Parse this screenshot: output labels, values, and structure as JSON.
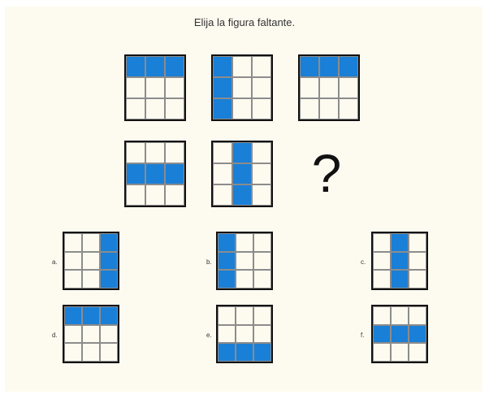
{
  "prompt": "Elija la figura faltante.",
  "question_mark": "?",
  "colors": {
    "fill": "#1a7fd6",
    "background": "#fdfbf0",
    "border": "#111111"
  },
  "puzzle": [
    [
      1,
      1,
      1,
      0,
      0,
      0,
      0,
      0,
      0
    ],
    [
      1,
      0,
      0,
      1,
      0,
      0,
      1,
      0,
      0
    ],
    [
      1,
      1,
      1,
      0,
      0,
      0,
      0,
      0,
      0
    ],
    [
      0,
      0,
      0,
      1,
      1,
      1,
      0,
      0,
      0
    ],
    [
      0,
      1,
      0,
      0,
      1,
      0,
      0,
      1,
      0
    ]
  ],
  "options": [
    {
      "label": "a.",
      "cells": [
        0,
        0,
        1,
        0,
        0,
        1,
        0,
        0,
        1
      ]
    },
    {
      "label": "b.",
      "cells": [
        1,
        0,
        0,
        1,
        0,
        0,
        1,
        0,
        0
      ]
    },
    {
      "label": "c.",
      "cells": [
        0,
        1,
        0,
        0,
        1,
        0,
        0,
        1,
        0
      ]
    },
    {
      "label": "d.",
      "cells": [
        1,
        1,
        1,
        0,
        0,
        0,
        0,
        0,
        0
      ]
    },
    {
      "label": "e.",
      "cells": [
        0,
        0,
        0,
        0,
        0,
        0,
        1,
        1,
        1
      ]
    },
    {
      "label": "f.",
      "cells": [
        0,
        0,
        0,
        1,
        1,
        1,
        0,
        0,
        0
      ]
    }
  ]
}
